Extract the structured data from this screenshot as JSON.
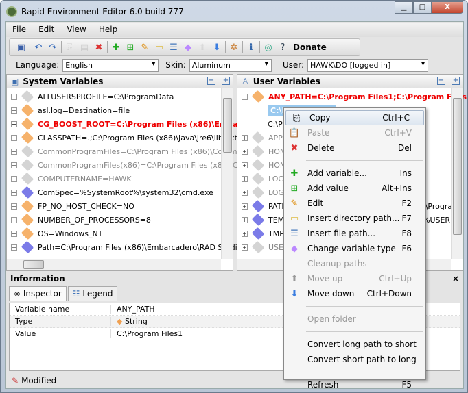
{
  "window": {
    "title": "Rapid Environment Editor 6.0 build 777",
    "min": "▁",
    "max": "□",
    "close": "X"
  },
  "menu": [
    "File",
    "Edit",
    "View",
    "Help"
  ],
  "toolbar": {
    "donate": "Donate",
    "icons": [
      "save-icon",
      "undo-icon",
      "redo-icon",
      "copy-icon",
      "paste-icon",
      "delete-icon",
      "add-variable-icon",
      "add-value-icon",
      "edit-icon",
      "insert-directory-icon",
      "insert-file-icon",
      "change-type-icon",
      "move-up-icon",
      "move-down-icon",
      "settings-icon",
      "info-panel-icon",
      "web-update-icon",
      "help-icon"
    ]
  },
  "options": {
    "language_label": "Language:",
    "language": "English",
    "skin_label": "Skin:",
    "skin": "Aluminum",
    "user_label": "User:",
    "user": "HAWK\\DO [logged in]"
  },
  "system": {
    "title": "System Variables",
    "rows": [
      {
        "text": "ALLUSERSPROFILE=C:\\ProgramData",
        "style": "gray-tag",
        "cls": ""
      },
      {
        "text": "asl.log=Destination=file",
        "style": "orange",
        "cls": ""
      },
      {
        "text": "CG_BOOST_ROOT=C:\\Program Files (x86)\\Embarcadero",
        "style": "error",
        "cls": "red"
      },
      {
        "text": "CLASSPATH=.;C:\\Program Files (x86)\\Java\\jre6\\lib\\ext",
        "style": "orange",
        "cls": ""
      },
      {
        "text": "CommonProgramFiles=C:\\Program Files (x86)\\Common Files",
        "style": "gray",
        "cls": "gray"
      },
      {
        "text": "CommonProgramFiles(x86)=C:\\Program Files (x86)\\Common Files",
        "style": "gray",
        "cls": "gray"
      },
      {
        "text": "COMPUTERNAME=HAWK",
        "style": "gray",
        "cls": "gray"
      },
      {
        "text": "ComSpec=%SystemRoot%\\system32\\cmd.exe",
        "style": "blue",
        "cls": ""
      },
      {
        "text": "FP_NO_HOST_CHECK=NO",
        "style": "orange",
        "cls": ""
      },
      {
        "text": "NUMBER_OF_PROCESSORS=8",
        "style": "orange",
        "cls": ""
      },
      {
        "text": "OS=Windows_NT",
        "style": "orange",
        "cls": ""
      },
      {
        "text": "Path=C:\\Program Files (x86)\\Embarcadero\\RAD Studio\\",
        "style": "blue",
        "cls": ""
      }
    ]
  },
  "user": {
    "title": "User Variables",
    "rows": [
      {
        "text": "ANY_PATH=C:\\Program Files1;C:\\Program Files",
        "style": "error",
        "cls": "red",
        "exp": "−"
      },
      {
        "text": "C:\\Pr",
        "style": "",
        "cls": "sel",
        "child": true
      },
      {
        "text": "C:\\Pr",
        "style": "",
        "cls": "",
        "child": true
      },
      {
        "text": "APPD",
        "style": "gray",
        "cls": "gray"
      },
      {
        "text": "HOME",
        "style": "gray",
        "cls": "gray"
      },
      {
        "text": "HOME",
        "style": "gray",
        "cls": "gray"
      },
      {
        "text": "LOCA",
        "style": "gray",
        "cls": "gray"
      },
      {
        "text": "LOGO",
        "style": "gray",
        "cls": "gray"
      },
      {
        "text": "PATH",
        "style": "blue",
        "cls": "",
        "tail": ":\\Progra"
      },
      {
        "text": "TEMP",
        "style": "blue",
        "cls": "",
        "tail": "%USER"
      },
      {
        "text": "TMP=",
        "style": "blue",
        "cls": ""
      },
      {
        "text": "USER",
        "style": "gray",
        "cls": "gray"
      }
    ]
  },
  "info": {
    "title": "Information",
    "close": "×",
    "tabs": [
      "Inspector",
      "Legend"
    ],
    "rows": [
      [
        "Variable name",
        "ANY_PATH"
      ],
      [
        "Type",
        "String"
      ],
      [
        "Value",
        "C:\\Program Files1"
      ]
    ]
  },
  "status": {
    "text": "Modified"
  },
  "context_menu": [
    {
      "label": "Copy",
      "shortcut": "Ctrl+C",
      "icon": "copy-icon",
      "glyph": "⎘",
      "state": "hl"
    },
    {
      "label": "Paste",
      "shortcut": "Ctrl+V",
      "icon": "paste-icon",
      "glyph": "📋",
      "state": "dis"
    },
    {
      "label": "Delete",
      "shortcut": "Del",
      "icon": "delete-icon",
      "glyph": "✖",
      "color": "#d33"
    },
    {
      "sep": true
    },
    {
      "label": "Add variable...",
      "shortcut": "Ins",
      "icon": "add-variable-icon",
      "glyph": "✚",
      "color": "#2a2"
    },
    {
      "label": "Add value",
      "shortcut": "Alt+Ins",
      "icon": "add-value-icon",
      "glyph": "⊞",
      "color": "#2a2"
    },
    {
      "label": "Edit",
      "shortcut": "F2",
      "icon": "pencil-icon",
      "glyph": "✎",
      "color": "#d80"
    },
    {
      "label": "Insert directory path...",
      "shortcut": "F7",
      "icon": "folder-icon",
      "glyph": "▭",
      "color": "#db4"
    },
    {
      "label": "Insert file path...",
      "shortcut": "F8",
      "icon": "file-icon",
      "glyph": "☰",
      "color": "#47b"
    },
    {
      "label": "Change variable type",
      "shortcut": "F6",
      "icon": "tag-icon",
      "glyph": "◆",
      "color": "#b8f"
    },
    {
      "label": "Cleanup paths",
      "shortcut": "",
      "icon": "",
      "glyph": "",
      "state": "dis"
    },
    {
      "label": "Move up",
      "shortcut": "Ctrl+Up",
      "icon": "arrow-up-icon",
      "glyph": "⬆",
      "state": "dis"
    },
    {
      "label": "Move down",
      "shortcut": "Ctrl+Down",
      "icon": "arrow-down-icon",
      "glyph": "⬇",
      "color": "#3a7de0"
    },
    {
      "sep": true
    },
    {
      "label": "Open folder",
      "shortcut": "",
      "icon": "",
      "glyph": "",
      "state": "dis"
    },
    {
      "sep": true
    },
    {
      "label": "Convert long path to short",
      "shortcut": "",
      "icon": "",
      "glyph": ""
    },
    {
      "label": "Convert short path to long",
      "shortcut": "",
      "icon": "",
      "glyph": ""
    },
    {
      "sep": true
    },
    {
      "label": "Refresh",
      "shortcut": "F5",
      "icon": "",
      "glyph": ""
    }
  ],
  "colors": {
    "error": "#ee0000",
    "orange_tag": "#f6b26b",
    "blue_tag": "#7b7be8",
    "gray_tag": "#cccccc",
    "selection": "#99c9ef"
  }
}
